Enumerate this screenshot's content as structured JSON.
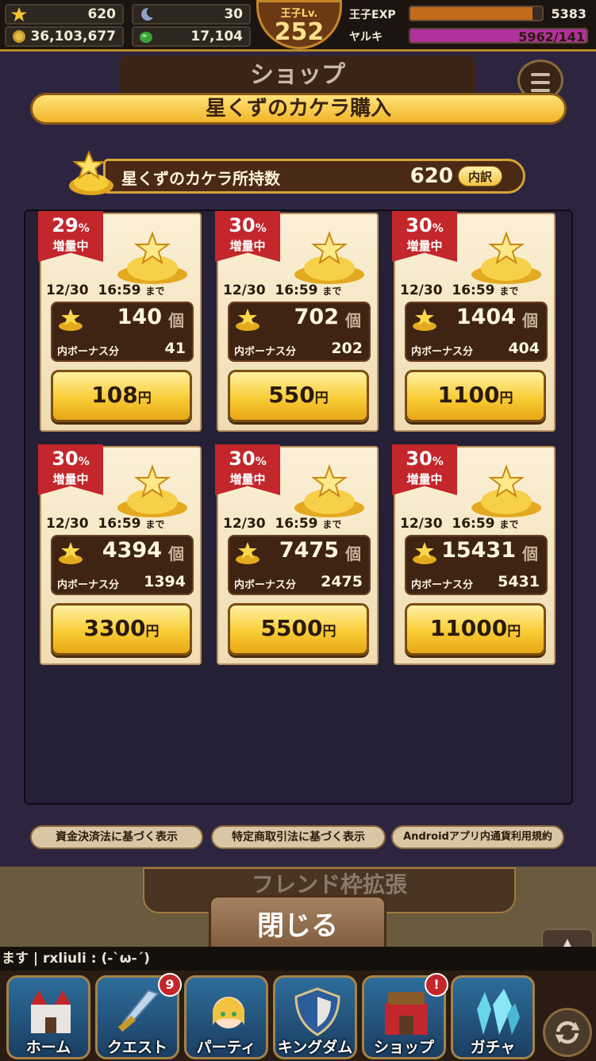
{
  "top_bar": {
    "stars": "620",
    "moon": "30",
    "coins": "36,103,677",
    "gems": "17,104",
    "level_label": "王子Lv.",
    "level": "252",
    "exp_label": "王子EXP",
    "exp_value": "5383",
    "exp_progress": 0.93,
    "yaruki_label": "ヤルキ",
    "yaruki_value": "5962/141",
    "yaruki_progress": 1.0
  },
  "shop": {
    "tab_title": "ショップ",
    "header": "星くずのカケラ購入",
    "holding_label": "星くずのカケラ所持数",
    "holding_count": "620",
    "detail_button": "内訳"
  },
  "products": [
    {
      "bonus_pct": "29",
      "pct_sign": "%",
      "tag": "増量中",
      "deadline_date": "12/30",
      "deadline_time": "16:59",
      "deadline_suffix": "まで",
      "amount": "140",
      "unit": "個",
      "bonus_label": "内ボーナス分",
      "bonus": "41",
      "price": "108",
      "currency": "円"
    },
    {
      "bonus_pct": "30",
      "pct_sign": "%",
      "tag": "増量中",
      "deadline_date": "12/30",
      "deadline_time": "16:59",
      "deadline_suffix": "まで",
      "amount": "702",
      "unit": "個",
      "bonus_label": "内ボーナス分",
      "bonus": "202",
      "price": "550",
      "currency": "円"
    },
    {
      "bonus_pct": "30",
      "pct_sign": "%",
      "tag": "増量中",
      "deadline_date": "12/30",
      "deadline_time": "16:59",
      "deadline_suffix": "まで",
      "amount": "1404",
      "unit": "個",
      "bonus_label": "内ボーナス分",
      "bonus": "404",
      "price": "1100",
      "currency": "円"
    },
    {
      "bonus_pct": "30",
      "pct_sign": "%",
      "tag": "増量中",
      "deadline_date": "12/30",
      "deadline_time": "16:59",
      "deadline_suffix": "まで",
      "amount": "4394",
      "unit": "個",
      "bonus_label": "内ボーナス分",
      "bonus": "1394",
      "price": "3300",
      "currency": "円"
    },
    {
      "bonus_pct": "30",
      "pct_sign": "%",
      "tag": "増量中",
      "deadline_date": "12/30",
      "deadline_time": "16:59",
      "deadline_suffix": "まで",
      "amount": "7475",
      "unit": "個",
      "bonus_label": "内ボーナス分",
      "bonus": "2475",
      "price": "5500",
      "currency": "円"
    },
    {
      "bonus_pct": "30",
      "pct_sign": "%",
      "tag": "増量中",
      "deadline_date": "12/30",
      "deadline_time": "16:59",
      "deadline_suffix": "まで",
      "amount": "15431",
      "unit": "個",
      "bonus_label": "内ボーナス分",
      "bonus": "5431",
      "price": "11000",
      "currency": "円"
    }
  ],
  "legal_links": [
    "資金決済法に基づく表示",
    "特定商取引法に基づく表示",
    "Androidアプリ内通貨利用規約"
  ],
  "friend_banner": "フレンド枠拡張",
  "close_button": "閉じる",
  "chat_text": "ます | rxliuli : (-`ω-´)",
  "nav": [
    {
      "label": "ホーム",
      "icon": "castle-icon"
    },
    {
      "label": "クエスト",
      "icon": "sword-icon",
      "badge": "9"
    },
    {
      "label": "パーティ",
      "icon": "princess-icon"
    },
    {
      "label": "キングダム",
      "icon": "shield-icon"
    },
    {
      "label": "ショップ",
      "icon": "shop-icon",
      "badge": "!"
    },
    {
      "label": "ガチャ",
      "icon": "crystal-icon"
    }
  ],
  "colors": {
    "ribbon": "#c3262b",
    "gold": "#f8cc35",
    "frame": "#2d2540",
    "exp": "#c46a1a",
    "yaruki": "#b0329a"
  }
}
